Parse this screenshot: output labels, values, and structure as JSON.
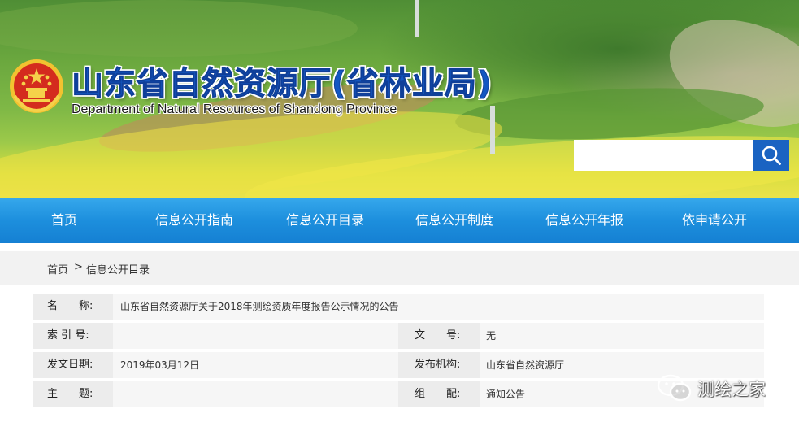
{
  "banner": {
    "title_cn": "山东省自然资源厅(省林业局)",
    "title_en": "Department of Natural Resources of Shandong Province",
    "search": {
      "placeholder": "",
      "value": ""
    },
    "colors": {
      "title": "#1457c2",
      "search_button": "#1a63c2"
    }
  },
  "nav": {
    "items": [
      {
        "label": "首页"
      },
      {
        "label": "信息公开指南"
      },
      {
        "label": "信息公开目录"
      },
      {
        "label": "信息公开制度"
      },
      {
        "label": "信息公开年报"
      },
      {
        "label": "依申请公开"
      }
    ],
    "colors": {
      "bar": "#1d8fdd",
      "text": "#ffffff"
    }
  },
  "breadcrumb": {
    "home": "首页",
    "separator": ">",
    "current": "信息公开目录"
  },
  "info": {
    "name_label": "名　　称:",
    "name_value": "山东省自然资源厅关于2018年测绘资质年度报告公示情况的公告",
    "index_label": "索 引 号:",
    "index_value": "",
    "doc_no_label": "文　　号:",
    "doc_no_value": "无",
    "date_label": "发文日期:",
    "date_value": "2019年03月12日",
    "issuer_label": "发布机构:",
    "issuer_value": "山东省自然资源厅",
    "subject_label": "主　　题:",
    "subject_value": "",
    "category_label": "组　　配:",
    "category_value": "通知公告"
  },
  "watermark": {
    "icon": "wechat-icon",
    "text": "测绘之家"
  }
}
